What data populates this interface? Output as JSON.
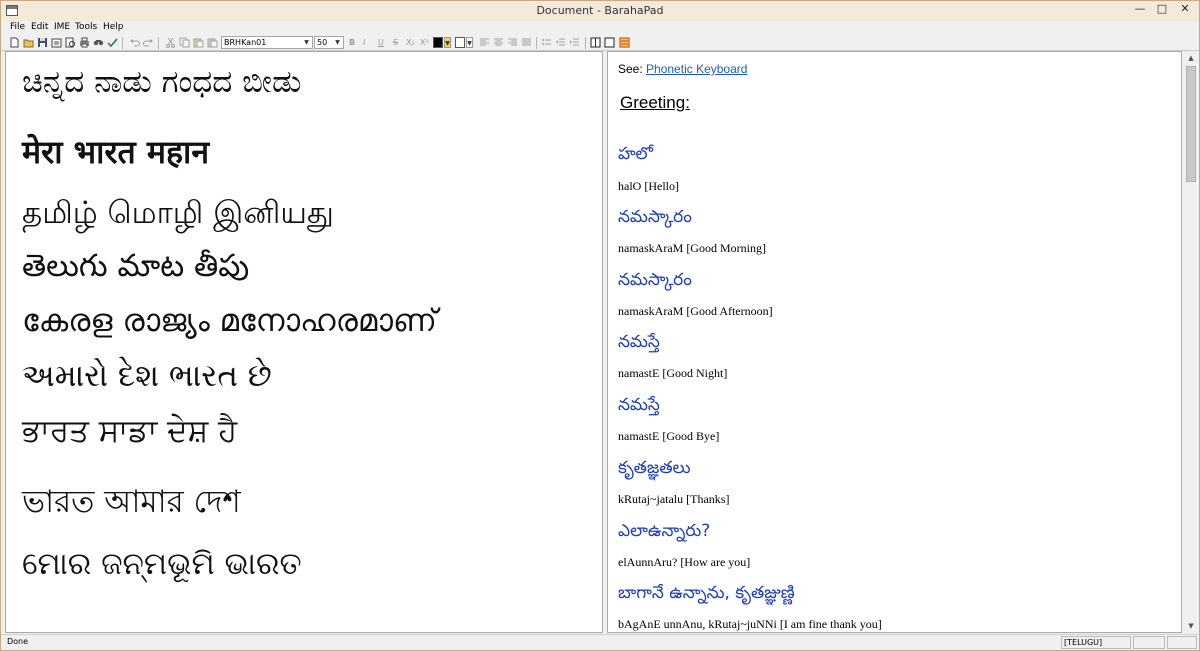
{
  "window": {
    "title": "Document - BarahaPad"
  },
  "menu": {
    "file": "File",
    "edit": "Edit",
    "ime": "IME",
    "tools": "Tools",
    "help": "Help"
  },
  "toolbar": {
    "font_name": "BRHKan01",
    "font_size": "50",
    "bold": "B",
    "italic": "I",
    "underline": "U",
    "strike": "S",
    "subscript": "X₂",
    "superscript": "X²",
    "text_color": "#000000",
    "highlight_color": "#ffffff"
  },
  "editor": {
    "lines": [
      "ಚಿನ್ನದ ನಾಡು ಗಂಧದ ಬೀಡು",
      "मेरा  भारत  महान",
      "தமிழ் மொழி இனியது",
      "తెలుగు మాట తీపు",
      "കേരള രാജ്യം മനോഹരമാണ്",
      "અમારો દેશ ભારત છે",
      "ਭਾਰਤ ਸਾਡਾ ਦੇਸ਼ ਹੈ",
      "ভারত আমার দেশ",
      "ମୋର ଜନ୍ମଭୂମି ଭାରତ"
    ]
  },
  "preview": {
    "see_label": "See:",
    "see_link": "Phonetic Keyboard",
    "heading": "Greeting:",
    "entries": [
      {
        "telugu": "హలో",
        "translit": "halO [Hello]"
      },
      {
        "telugu": "నమస్కారం",
        "translit": "namaskAraM [Good Morning]"
      },
      {
        "telugu": "నమస్కారం",
        "translit": "namaskAraM [Good Afternoon]"
      },
      {
        "telugu": "నమస్తే",
        "translit": "namastE [Good Night]"
      },
      {
        "telugu": "నమస్తే",
        "translit": "namastE [Good Bye]"
      },
      {
        "telugu": "కృతజ్ఞతలు",
        "translit": "kRutaj~jatalu [Thanks]"
      },
      {
        "telugu": "ఎలాఉన్నారు?",
        "translit": "elAunnAru? [How are you]"
      },
      {
        "telugu": "బాగానే ఉన్నాను, కృతజ్ఞుణ్ణి",
        "translit": "bAgAnE unnAnu, kRutaj~juNNi [I am fine thank you]"
      }
    ]
  },
  "status": {
    "text": "Done",
    "lang": "[TELUGU]"
  }
}
